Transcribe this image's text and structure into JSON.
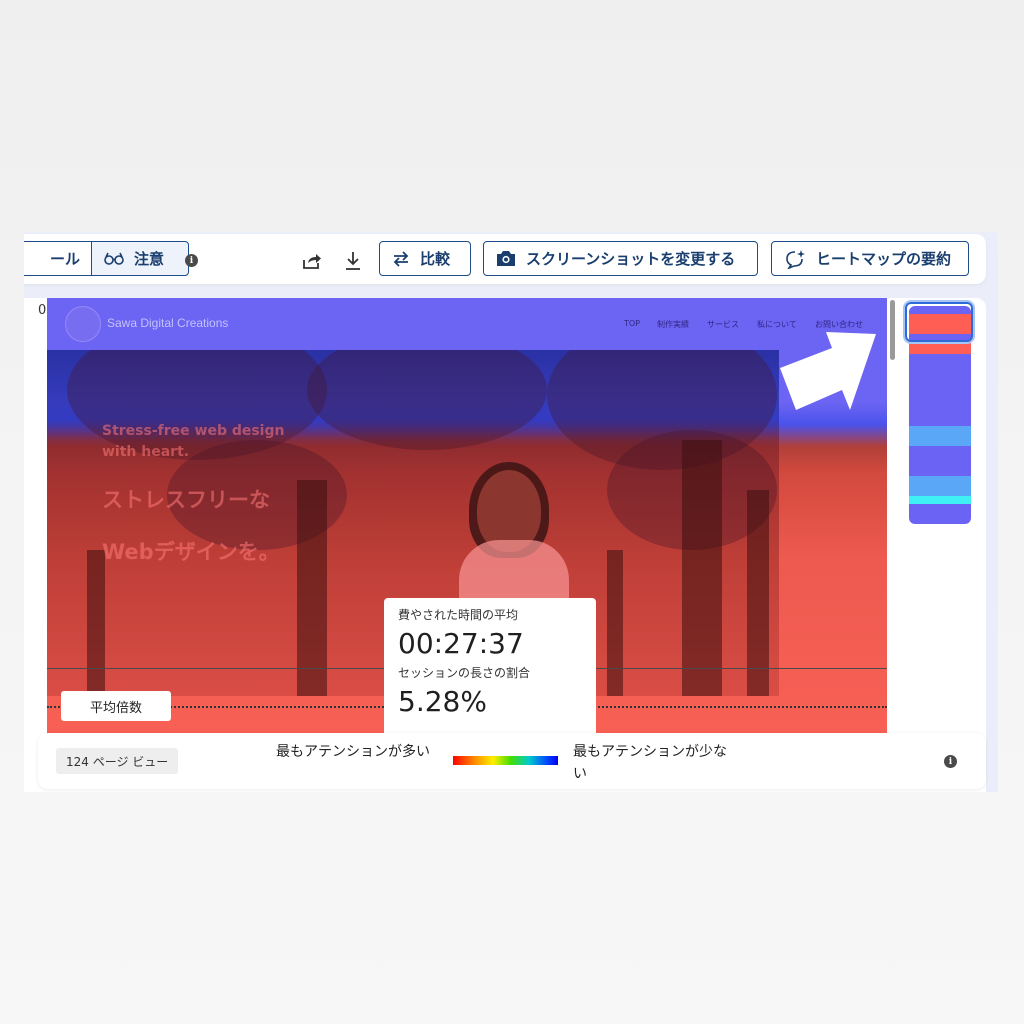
{
  "toolbar": {
    "segment_left_label": "ール",
    "segment_right_label": "注意",
    "compare_label": "比較",
    "change_screenshot_label": "スクリーンショットを変更する",
    "summary_label": "ヒートマップの要約"
  },
  "panel": {
    "scroll_top_value": "0",
    "avg_fold_label": "平均倍数"
  },
  "site": {
    "name": "Sawa Digital Creations",
    "nav": [
      "TOP",
      "制作実績",
      "サービス",
      "私について",
      "お問い合わせ"
    ],
    "tagline_en_1": "Stress-free web design",
    "tagline_en_2": "with heart.",
    "tagline_jp_1": "ストレスフリーな",
    "tagline_jp_2": "Webデザインを。"
  },
  "tooltip": {
    "time_label": "費やされた時間の平均",
    "time_value": "00:27:37",
    "session_label": "セッションの長さの割合",
    "session_value": "5.28%"
  },
  "legend": {
    "page_views": "124 ページ ビュー",
    "most_attention": "最もアテンションが多い",
    "least_attention": "最もアテンションが少ない"
  },
  "colors": {
    "accent": "#1d4e89",
    "heat_high": "#ff5e55",
    "heat_low": "#6b63f3"
  }
}
